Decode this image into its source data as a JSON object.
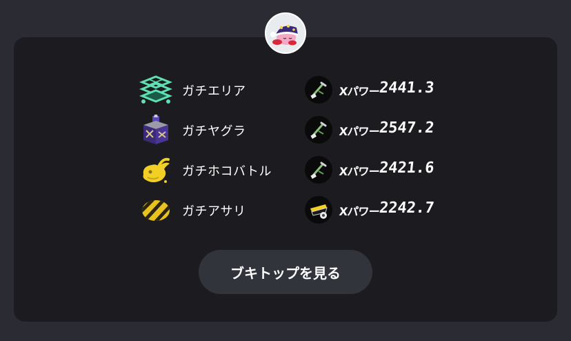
{
  "profile": {
    "avatar_icon": "kirby-avatar-icon"
  },
  "modes": [
    {
      "name": "ガチエリア",
      "icon": "splat-zones-icon",
      "weapon_icon": "splatana-weapon-icon",
      "x_label": "Xパワー",
      "x_power": "2441.3"
    },
    {
      "name": "ガチヤグラ",
      "icon": "tower-control-icon",
      "weapon_icon": "splatana-weapon-icon",
      "x_label": "Xパワー",
      "x_power": "2547.2"
    },
    {
      "name": "ガチホコバトル",
      "icon": "rainmaker-icon",
      "weapon_icon": "splatana-weapon-icon",
      "x_label": "Xパワー",
      "x_power": "2421.6"
    },
    {
      "name": "ガチアサリ",
      "icon": "clam-blitz-icon",
      "weapon_icon": "stamper-weapon-icon",
      "x_label": "Xパワー",
      "x_power": "2242.7"
    }
  ],
  "button": {
    "label": "ブキトップを見る"
  },
  "colors": {
    "page_bg": "#2b2c33",
    "card_bg": "#1c1c20",
    "button_bg": "#32343c",
    "zones": "#5fe0b0",
    "tower": "#6b4fc8",
    "rainmaker": "#f2cf24",
    "clam": "#e8c21e"
  }
}
